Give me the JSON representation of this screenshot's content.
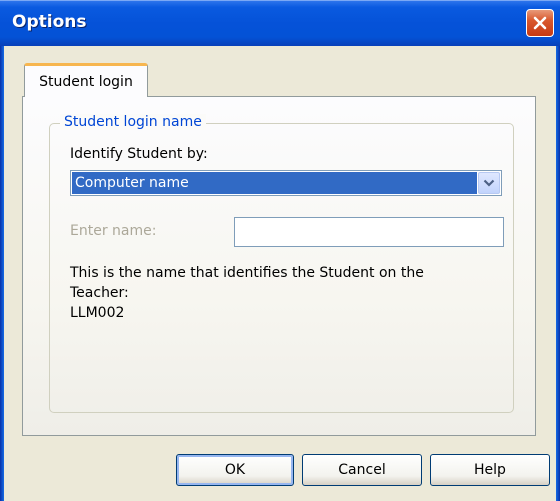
{
  "window": {
    "title": "Options"
  },
  "tabs": [
    {
      "label": "Student login",
      "selected": true
    }
  ],
  "group": {
    "legend": "Student login name",
    "identify_label": "Identify Student by:",
    "identify_select": {
      "selected": "Computer name"
    },
    "enter_name_label": "Enter name:",
    "enter_name_value": "",
    "info_line1": "This is the name that identifies the Student on the",
    "info_line2": "Teacher:",
    "student_name": "LLM002"
  },
  "buttons": {
    "ok": "OK",
    "cancel": "Cancel",
    "help": "Help"
  },
  "colors": {
    "accent": "#316ac5",
    "legend": "#0046d5",
    "titlebar": "#0552d8",
    "close": "#c63a14"
  }
}
